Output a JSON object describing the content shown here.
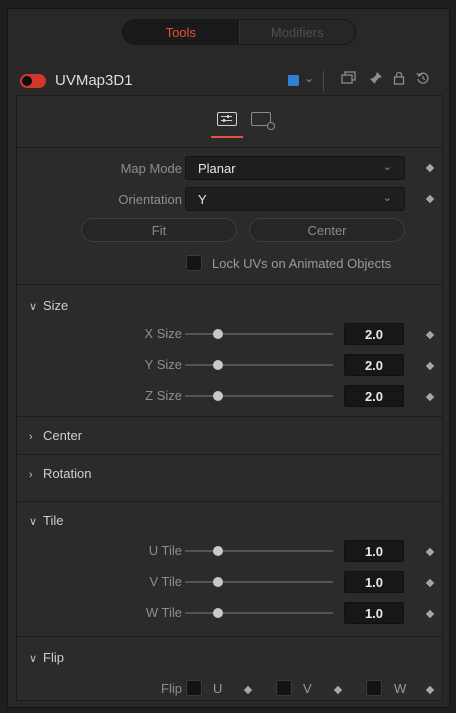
{
  "tabs": {
    "tools": "Tools",
    "modifiers": "Modifiers"
  },
  "header": {
    "tool_name": "UVMap3D1",
    "color": "#2f7fd4"
  },
  "map_mode": {
    "label": "Map Mode",
    "value": "Planar"
  },
  "orientation": {
    "label": "Orientation",
    "value": "Y"
  },
  "buttons": {
    "fit": "Fit",
    "center": "Center"
  },
  "lock_uvs": {
    "label": "Lock UVs on Animated Objects",
    "checked": false
  },
  "size": {
    "title": "Size",
    "rows": [
      {
        "label": "X Size",
        "value": "2.0"
      },
      {
        "label": "Y Size",
        "value": "2.0"
      },
      {
        "label": "Z Size",
        "value": "2.0"
      }
    ]
  },
  "center_section": {
    "title": "Center"
  },
  "rotation_section": {
    "title": "Rotation"
  },
  "tile": {
    "title": "Tile",
    "rows": [
      {
        "label": "U Tile",
        "value": "1.0"
      },
      {
        "label": "V Tile",
        "value": "1.0"
      },
      {
        "label": "W Tile",
        "value": "1.0"
      }
    ]
  },
  "flip": {
    "title": "Flip",
    "label": "Flip",
    "u": "U",
    "v": "V",
    "w": "W"
  },
  "accent": "#e4503c"
}
